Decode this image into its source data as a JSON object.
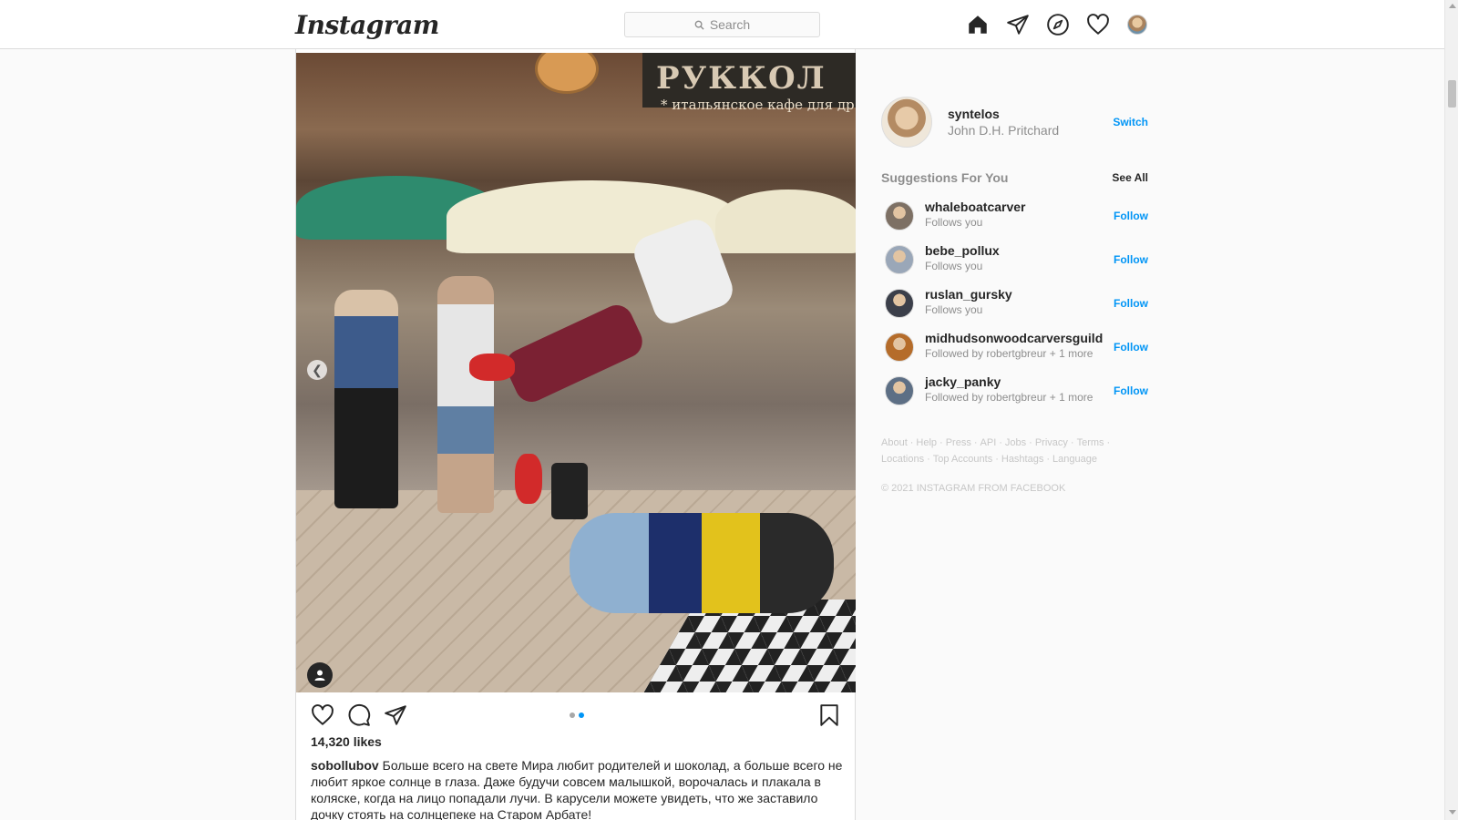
{
  "app": {
    "logo": "Instagram"
  },
  "search": {
    "placeholder": "Search"
  },
  "nav": {
    "icons": [
      "home-icon",
      "direct-icon",
      "explore-icon",
      "activity-heart-icon",
      "profile-avatar"
    ]
  },
  "post": {
    "media_sign_text": "РУККОЛ",
    "media_sign_sub": "* итальянское кафе для др",
    "carousel": {
      "count": 2,
      "active_index": 1
    },
    "likes": "14,320 likes",
    "author": "sobollubov",
    "caption": "Больше всего на свете Мира любит родителей и шоколад, а больше всего не любит яркое солнце в глаза. Даже будучи совсем малышкой, ворочалась и плакала в коляске, когда на лицо попадали лучи. В карусели можете увидеть, что же заставило дочку стоять на солнцепеке на Старом Арбате!"
  },
  "me": {
    "username": "syntelos",
    "full_name": "John D.H. Pritchard",
    "switch_label": "Switch"
  },
  "suggestions": {
    "title": "Suggestions For You",
    "see_all": "See All",
    "follow_label": "Follow",
    "items": [
      {
        "username": "whaleboatcarver",
        "subtitle": "Follows you",
        "avatar_color": "#7d7064"
      },
      {
        "username": "bebe_pollux",
        "subtitle": "Follows you",
        "avatar_color": "#9aa7b8"
      },
      {
        "username": "ruslan_gursky",
        "subtitle": "Follows you",
        "avatar_color": "#3b3f4a"
      },
      {
        "username": "midhudsonwoodcarversguild",
        "subtitle": "Followed by robertgbreur + 1 more",
        "avatar_color": "#b56c2a"
      },
      {
        "username": "jacky_panky",
        "subtitle": "Followed by robertgbreur + 1 more",
        "avatar_color": "#5d6f85"
      }
    ]
  },
  "footer": {
    "links": [
      "About",
      "Help",
      "Press",
      "API",
      "Jobs",
      "Privacy",
      "Terms",
      "Locations",
      "Top Accounts",
      "Hashtags",
      "Language"
    ],
    "copyright": "© 2021 INSTAGRAM FROM FACEBOOK"
  },
  "colors": {
    "accent": "#0095f6",
    "text": "#262626",
    "muted": "#8e8e8e",
    "border": "#dbdbdb"
  }
}
